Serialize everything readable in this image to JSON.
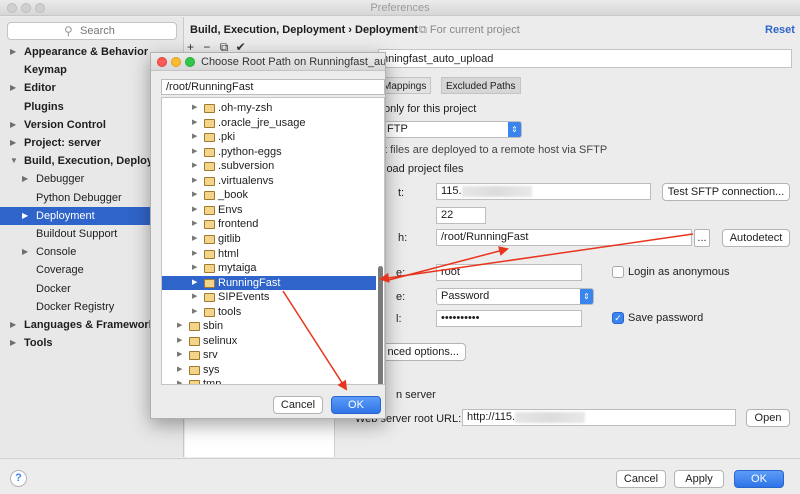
{
  "window": {
    "title": "Preferences"
  },
  "sidebar": {
    "search_placeholder": "Search",
    "items": [
      {
        "label": "Appearance & Behavior",
        "bold": true,
        "arrow": "▶"
      },
      {
        "label": "Keymap",
        "bold": true,
        "arrow": ""
      },
      {
        "label": "Editor",
        "bold": true,
        "arrow": "▶"
      },
      {
        "label": "Plugins",
        "bold": true,
        "arrow": ""
      },
      {
        "label": "Version Control",
        "bold": true,
        "arrow": "▶"
      },
      {
        "label": "Project: server",
        "bold": true,
        "arrow": "▶"
      },
      {
        "label": "Build, Execution, Deployment",
        "bold": true,
        "arrow": "▼"
      },
      {
        "label": "Debugger",
        "bold": false,
        "arrow": "▶"
      },
      {
        "label": "Python Debugger",
        "bold": false,
        "arrow": ""
      },
      {
        "label": "Deployment",
        "bold": false,
        "arrow": "▶",
        "selected": true
      },
      {
        "label": "Buildout Support",
        "bold": false,
        "arrow": ""
      },
      {
        "label": "Console",
        "bold": false,
        "arrow": "▶"
      },
      {
        "label": "Coverage",
        "bold": false,
        "arrow": ""
      },
      {
        "label": "Docker",
        "bold": false,
        "arrow": ""
      },
      {
        "label": "Docker Registry",
        "bold": false,
        "arrow": ""
      },
      {
        "label": "Languages & Frameworks",
        "bold": true,
        "arrow": "▶"
      },
      {
        "label": "Tools",
        "bold": true,
        "arrow": "▶"
      }
    ]
  },
  "header": {
    "breadcrumb": "Build, Execution, Deployment › Deployment",
    "scope_note": "For current project",
    "reset_label": "Reset"
  },
  "server": {
    "name": "nningfast_auto_upload",
    "tabs": [
      "Mappings",
      "Excluded Paths"
    ],
    "visible_only_label": "only for this project",
    "type_value": "FTP",
    "type_description": "t files are deployed to a remote host via SFTP",
    "upload_section": "load project files",
    "host_label": "t:",
    "host_value": "115.",
    "test_button": "Test SFTP connection...",
    "port_value": "22",
    "root_label": "h:",
    "root_value": "/root/RunningFast",
    "browse_label": "...",
    "autodetect_button": "Autodetect",
    "user_label": "e:",
    "user_value": "root",
    "anonymous_label": "Login as anonymous",
    "auth_label": "e:",
    "auth_value": "Password",
    "password_label": "l:",
    "password_value": "••••••••••",
    "save_password_label": "Save password",
    "advanced_button": "nced options...",
    "browse_section": "n server",
    "web_root_label": "Web server root URL:",
    "web_root_value": "http://115.",
    "open_button": "Open"
  },
  "footer": {
    "help_label": "?",
    "cancel_label": "Cancel",
    "apply_label": "Apply",
    "ok_label": "OK"
  },
  "dialog": {
    "title": "Choose Root Path on Runningfast_auto...",
    "path_value": "/root/RunningFast",
    "tree": [
      {
        "name": ".oh-my-zsh",
        "level": 2,
        "arrow": "▶"
      },
      {
        "name": ".oracle_jre_usage",
        "level": 2,
        "arrow": "▶"
      },
      {
        "name": ".pki",
        "level": 2,
        "arrow": "▶"
      },
      {
        "name": ".python-eggs",
        "level": 2,
        "arrow": "▶"
      },
      {
        "name": ".subversion",
        "level": 2,
        "arrow": "▶"
      },
      {
        "name": ".virtualenvs",
        "level": 2,
        "arrow": "▶"
      },
      {
        "name": "_book",
        "level": 2,
        "arrow": "▶"
      },
      {
        "name": "Envs",
        "level": 2,
        "arrow": "▶"
      },
      {
        "name": "frontend",
        "level": 2,
        "arrow": "▶"
      },
      {
        "name": "gitlib",
        "level": 2,
        "arrow": "▶"
      },
      {
        "name": "html",
        "level": 2,
        "arrow": "▶"
      },
      {
        "name": "mytaiga",
        "level": 2,
        "arrow": "▶"
      },
      {
        "name": "RunningFast",
        "level": 2,
        "arrow": "▶",
        "selected": true
      },
      {
        "name": "SIPEvents",
        "level": 2,
        "arrow": "▶"
      },
      {
        "name": "tools",
        "level": 2,
        "arrow": "▶"
      },
      {
        "name": "sbin",
        "level": 1,
        "arrow": "▶"
      },
      {
        "name": "selinux",
        "level": 1,
        "arrow": "▶"
      },
      {
        "name": "srv",
        "level": 1,
        "arrow": "▶"
      },
      {
        "name": "sys",
        "level": 1,
        "arrow": "▶"
      },
      {
        "name": "tmp",
        "level": 1,
        "arrow": "▶"
      }
    ],
    "cancel_label": "Cancel",
    "ok_label": "OK"
  },
  "colors": {
    "selection": "#2f65ca",
    "primary_button": "#2f74e8",
    "annotation_arrow": "#e8341c"
  }
}
